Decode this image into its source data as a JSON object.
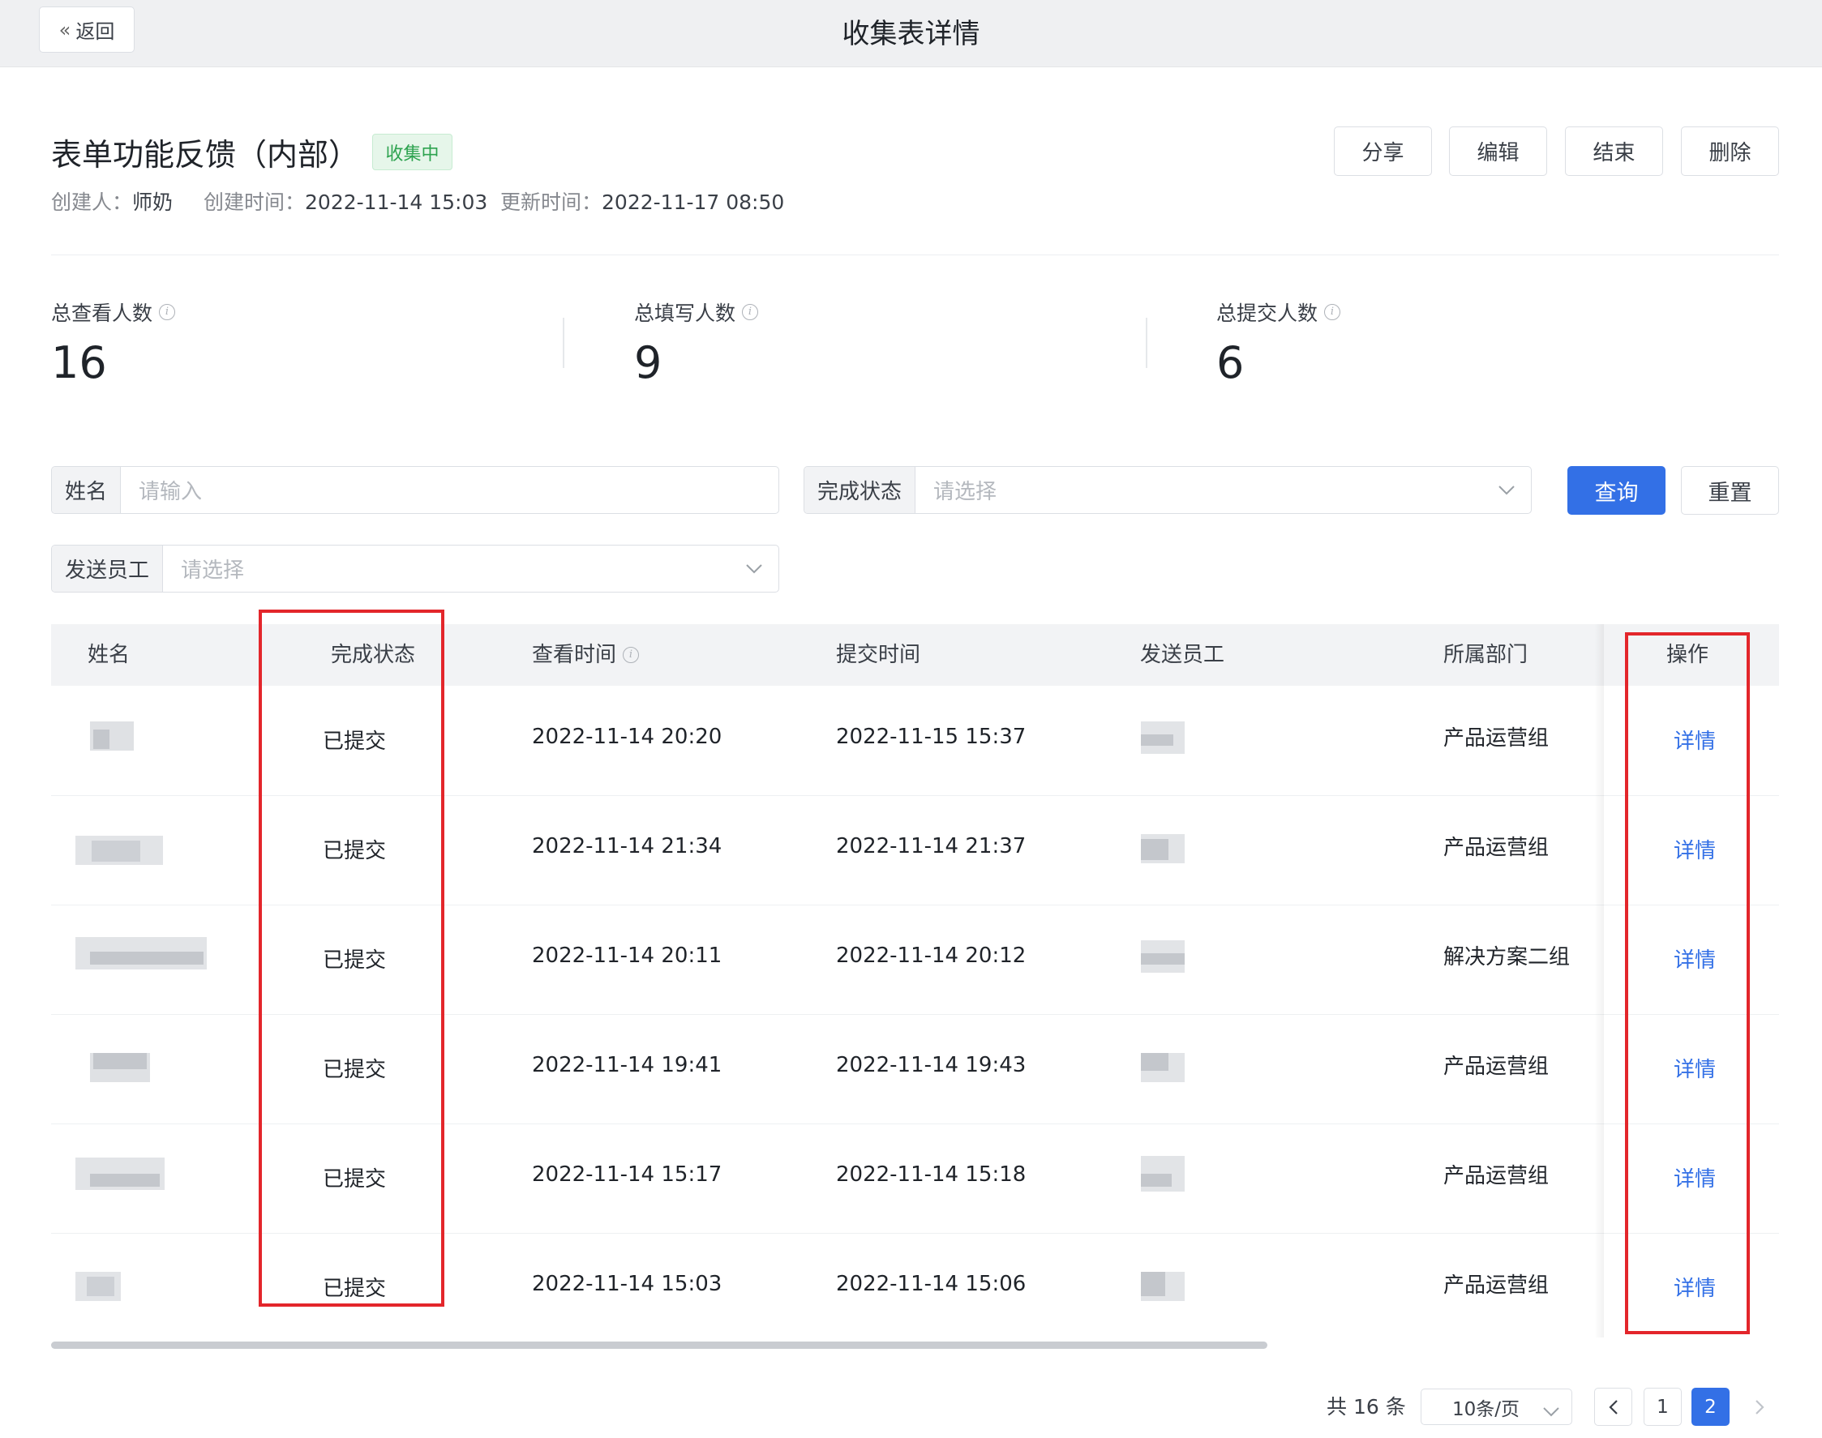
{
  "header": {
    "back_label": "返回",
    "title": "收集表详情"
  },
  "form": {
    "title": "表单功能反馈（内部）",
    "status": "收集中",
    "creator_label": "创建人：",
    "creator": "师奶",
    "created_label": "创建时间：",
    "created": "2022-11-14 15:03",
    "updated_label": "更新时间：",
    "updated": "2022-11-17 08:50"
  },
  "actions": {
    "share": "分享",
    "edit": "编辑",
    "end": "结束",
    "delete": "删除"
  },
  "stats": {
    "viewed_label": "总查看人数",
    "viewed": "16",
    "filled_label": "总填写人数",
    "filled": "9",
    "submitted_label": "总提交人数",
    "submitted": "6"
  },
  "filters": {
    "name_label": "姓名",
    "name_placeholder": "请输入",
    "status_label": "完成状态",
    "status_placeholder": "请选择",
    "sender_label": "发送员工",
    "sender_placeholder": "请选择",
    "query": "查询",
    "reset": "重置"
  },
  "table": {
    "headers": {
      "name": "姓名",
      "status": "完成状态",
      "viewed_time": "查看时间",
      "submit_time": "提交时间",
      "sender": "发送员工",
      "department": "所属部门",
      "actions": "操作"
    },
    "rows": [
      {
        "status": "已提交",
        "viewed_time": "2022-11-14 20:20",
        "submit_time": "2022-11-15 15:37",
        "department": "产品运营组",
        "action": "详情"
      },
      {
        "status": "已提交",
        "viewed_time": "2022-11-14 21:34",
        "submit_time": "2022-11-14 21:37",
        "department": "产品运营组",
        "action": "详情"
      },
      {
        "status": "已提交",
        "viewed_time": "2022-11-14 20:11",
        "submit_time": "2022-11-14 20:12",
        "department": "解决方案二组",
        "action": "详情"
      },
      {
        "status": "已提交",
        "viewed_time": "2022-11-14 19:41",
        "submit_time": "2022-11-14 19:43",
        "department": "产品运营组",
        "action": "详情"
      },
      {
        "status": "已提交",
        "viewed_time": "2022-11-14 15:17",
        "submit_time": "2022-11-14 15:18",
        "department": "产品运营组",
        "action": "详情"
      },
      {
        "status": "已提交",
        "viewed_time": "2022-11-14 15:03",
        "submit_time": "2022-11-14 15:06",
        "department": "产品运营组",
        "action": "详情"
      }
    ]
  },
  "pagination": {
    "total": "共 16 条",
    "page_size": "10条/页",
    "pages": [
      "1",
      "2"
    ],
    "current": "2"
  },
  "colors": {
    "primary": "#3370e6",
    "tag_green": "#2ea350",
    "highlight": "#e3262b"
  }
}
